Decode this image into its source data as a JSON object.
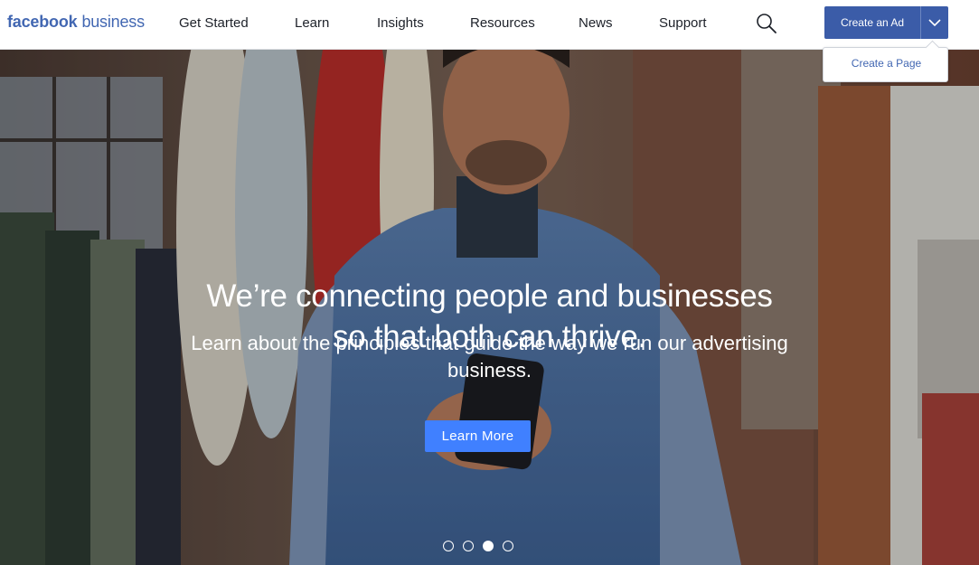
{
  "brand": {
    "facebook": "facebook",
    "business": "business",
    "color": "#4267b2"
  },
  "nav": {
    "items": [
      {
        "label": "Get Started"
      },
      {
        "label": "Learn"
      },
      {
        "label": "Insights"
      },
      {
        "label": "Resources"
      },
      {
        "label": "News"
      },
      {
        "label": "Support"
      }
    ],
    "search_icon": "search-icon"
  },
  "cta": {
    "primary_label": "Create an Ad",
    "caret_icon": "chevron-down-icon",
    "dropdown_item": "Create a Page",
    "color": "#3b5ca8"
  },
  "hero": {
    "headline_line1": "We’re connecting people and businesses",
    "headline_line2": "so that both can thrive.",
    "subline": "Learn about the principles that guide the way we run our advertising business.",
    "button_label": "Learn More",
    "button_color": "#4080ff",
    "carousel": {
      "count": 4,
      "active": 3
    }
  }
}
